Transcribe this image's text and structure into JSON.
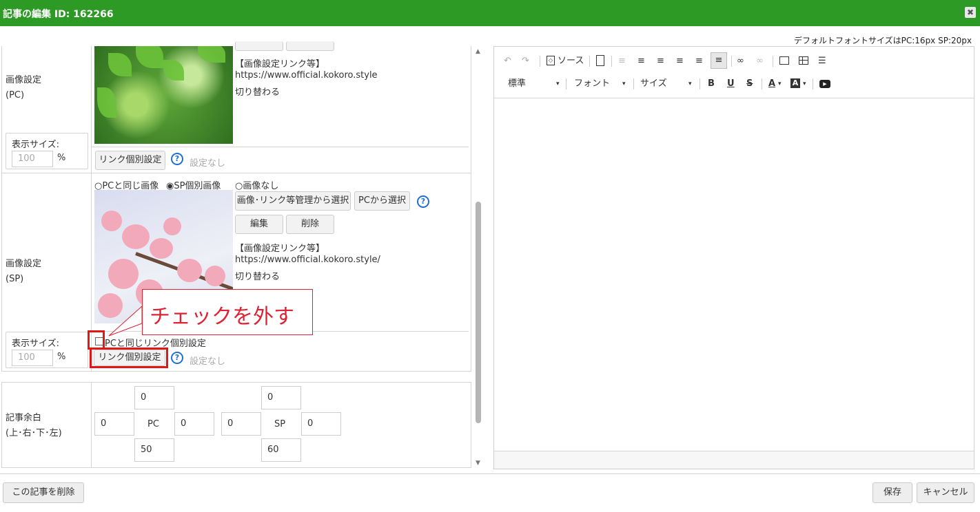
{
  "window": {
    "title": "記事の編集 ID: 162266",
    "close_glyph": "✖"
  },
  "font_note": "デフォルトフォントサイズはPC:16px SP:20px",
  "image_pc": {
    "label_line1": "画像設定",
    "label_line2": "(PC)",
    "link_title": "【画像設定リンク等】",
    "link_url": "https://www.official.kokoro.style",
    "link_note": "切り替わる",
    "size_label": "表示サイズ:",
    "size_value": "100",
    "size_unit": "%",
    "link_button": "リンク個別設定",
    "help": "?",
    "link_status": "設定なし"
  },
  "image_sp": {
    "label_line1": "画像設定",
    "label_line2": "(SP)",
    "radio_same": "○PCと同じ画像",
    "radio_sp": "◉SP個別画像",
    "radio_none": "○画像なし",
    "select_manage": "画像･リンク等管理から選択",
    "select_pc": "PCから選択",
    "help": "?",
    "edit": "編集",
    "delete": "削除",
    "link_title": "【画像設定リンク等】",
    "link_url": "https://www.official.kokoro.style/",
    "link_note": "切り替わる",
    "size_label": "表示サイズ:",
    "size_value": "100",
    "size_unit": "%",
    "checkbox_label": "PCと同じリンク個別設定",
    "link_button": "リンク個別設定",
    "link_help": "?",
    "link_status": "設定なし"
  },
  "annotation": {
    "callout": "チェックを外す"
  },
  "margin": {
    "label_line1": "記事余白",
    "label_line2": "(上･右･下･左)",
    "pc": {
      "label": "PC",
      "top": "0",
      "right": "0",
      "bottom": "50",
      "left": "0"
    },
    "sp": {
      "label": "SP",
      "top": "0",
      "right": "0",
      "bottom": "60",
      "left": "0"
    }
  },
  "toolbar": {
    "undo": "↶",
    "redo": "↷",
    "source": "ソース",
    "format": "標準",
    "font": "フォント",
    "size": "サイズ",
    "bold": "B",
    "underline": "U",
    "strike": "S",
    "text_color": "A",
    "bg_color": "A"
  },
  "footer": {
    "delete": "この記事を削除",
    "save": "保存",
    "cancel": "キャンセル"
  }
}
